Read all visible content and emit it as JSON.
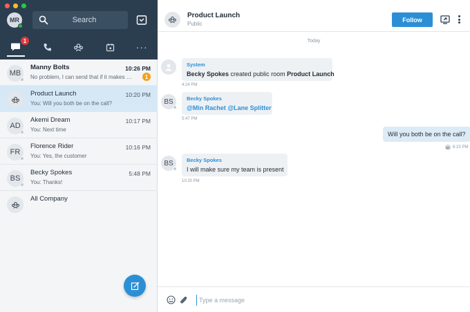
{
  "user": {
    "initials": "MR"
  },
  "search": {
    "placeholder": "Search"
  },
  "tabs": {
    "messages_badge": "1",
    "more": "···"
  },
  "conversations": [
    {
      "initials": "MB",
      "name": "Manny Bolts",
      "time": "10:26 PM",
      "preview": "No problem, I can send that if it makes …",
      "unread": "1"
    },
    {
      "name": "Product Launch",
      "time": "10:20 PM",
      "preview": "You: Will you both be on the call?"
    },
    {
      "initials": "AD",
      "name": "Akemi Dream",
      "time": "10:17 PM",
      "preview": "You: Next time"
    },
    {
      "initials": "FR",
      "name": "Florence Rider",
      "time": "10:16 PM",
      "preview": "You: Yes, the customer"
    },
    {
      "initials": "BS",
      "name": "Becky Spokes",
      "time": "5:48 PM",
      "preview": "You: Thanks!"
    },
    {
      "name": "All Company"
    }
  ],
  "header": {
    "title": "Product Launch",
    "subtitle": "Public",
    "follow_label": "Follow"
  },
  "chat": {
    "day_label": "Today",
    "messages": [
      {
        "sender": "System",
        "text_name": "Becky Spokes",
        "text_mid": " created public room ",
        "text_room": "Product Launch",
        "time": "4:24 PM"
      },
      {
        "initials": "BS",
        "sender": "Becky Spokes",
        "mention1": "@Min Rachet",
        "mention2": "@Lane Splitter",
        "time": "5:47 PM"
      },
      {
        "text": "Will you both be on the call?",
        "reader_initials": "BS",
        "time": "6:23 PM"
      },
      {
        "initials": "BS",
        "sender": "Becky Spokes",
        "text": "I will make sure my team is present",
        "time": "10:20 PM"
      }
    ]
  },
  "composer": {
    "placeholder": "Type a message"
  },
  "colors": {
    "sidebar_dark": "#2b3e50",
    "accent": "#2c8fd6",
    "selected": "#d6e8f6",
    "unread": "#f4a11a",
    "badge": "#e0373d"
  }
}
